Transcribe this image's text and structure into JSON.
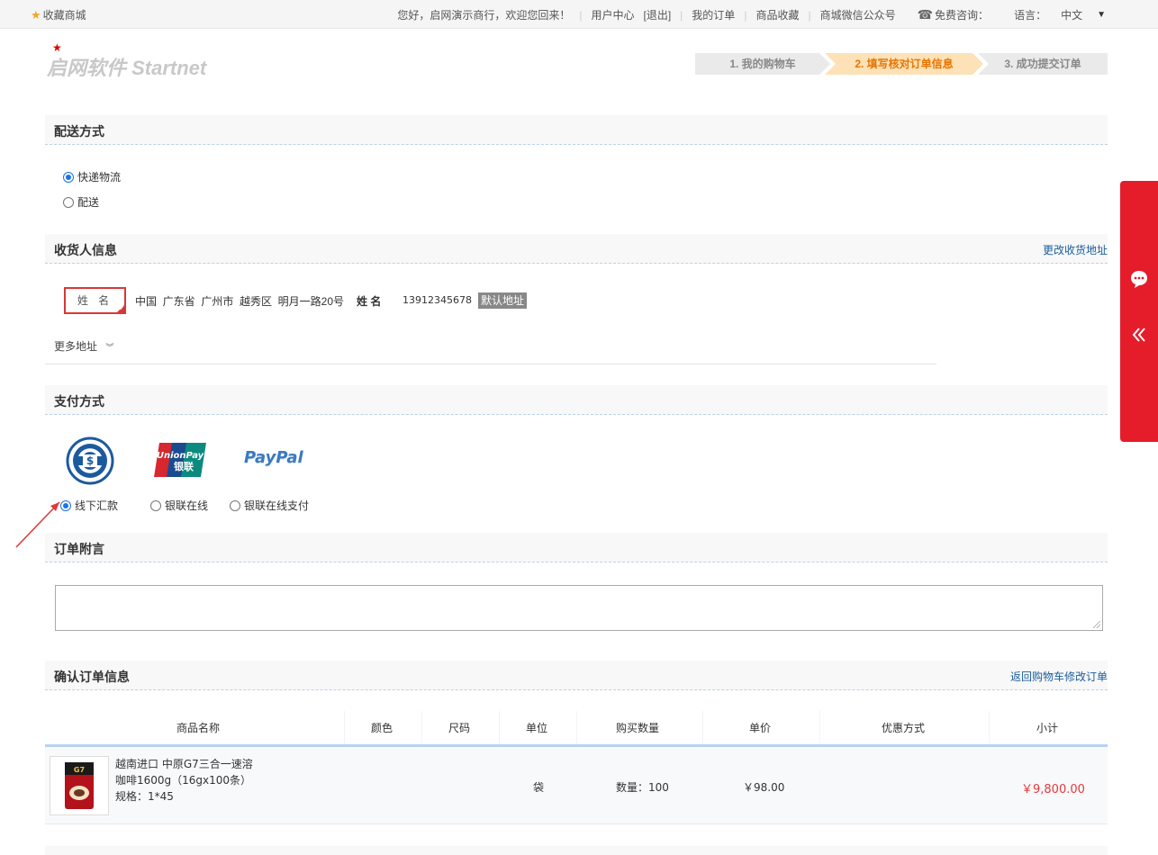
{
  "topbar": {
    "favorite": "收藏商城",
    "greeting": "您好，启网演示商行，欢迎您回来！",
    "user_center": "用户中心",
    "logout": "[退出]",
    "my_orders": "我的订单",
    "favorites": "商品收藏",
    "wechat": "商城微信公众号",
    "consult": "免费咨询：",
    "language_label": "语言：",
    "language_value": "中文"
  },
  "logo": {
    "text": "启网软件 Startnet"
  },
  "steps": [
    {
      "label": "1. 我的购物车",
      "state": "done"
    },
    {
      "label": "2. 填写核对订单信息",
      "state": "active"
    },
    {
      "label": "3. 成功提交订单",
      "state": "pending"
    }
  ],
  "delivery": {
    "title": "配送方式",
    "options": [
      {
        "label": "快递物流",
        "selected": true
      },
      {
        "label": "配送",
        "selected": false
      }
    ]
  },
  "receiver": {
    "title": "收货人信息",
    "change_link": "更改收货地址",
    "name_box": "姓 名",
    "address": "中国  广东省  广州市  越秀区  明月一路20号",
    "name_label": "姓 名",
    "phone": "13912345678",
    "default_badge": "默认地址",
    "more": "更多地址"
  },
  "payment": {
    "title": "支付方式",
    "options": [
      {
        "label": "线下汇款",
        "selected": true
      },
      {
        "label": "银联在线",
        "selected": false
      },
      {
        "label": "银联在线支付",
        "selected": false
      }
    ],
    "logos": {
      "unionpay_en": "UnionPay",
      "unionpay_cn": "银联",
      "paypal": "PayPal"
    }
  },
  "memo": {
    "title": "订单附言"
  },
  "confirm": {
    "title": "确认订单信息",
    "back_link": "返回购物车修改订单",
    "headers": [
      "商品名称",
      "颜色",
      "尺码",
      "单位",
      "购买数量",
      "单价",
      "优惠方式",
      "小计"
    ],
    "rows": [
      {
        "name_line1": "越南进口 中原G7三合一速溶",
        "name_line2": "咖啡1600g（16gx100条）",
        "spec": "规格：1*45",
        "unit": "袋",
        "quantity": "数量：100",
        "price": "￥98.00",
        "subtotal": "￥9,800.00"
      }
    ]
  },
  "colors": {
    "accent_red": "#e51c2a",
    "link_blue": "#1a5d9e",
    "step_active": "#e87400"
  }
}
